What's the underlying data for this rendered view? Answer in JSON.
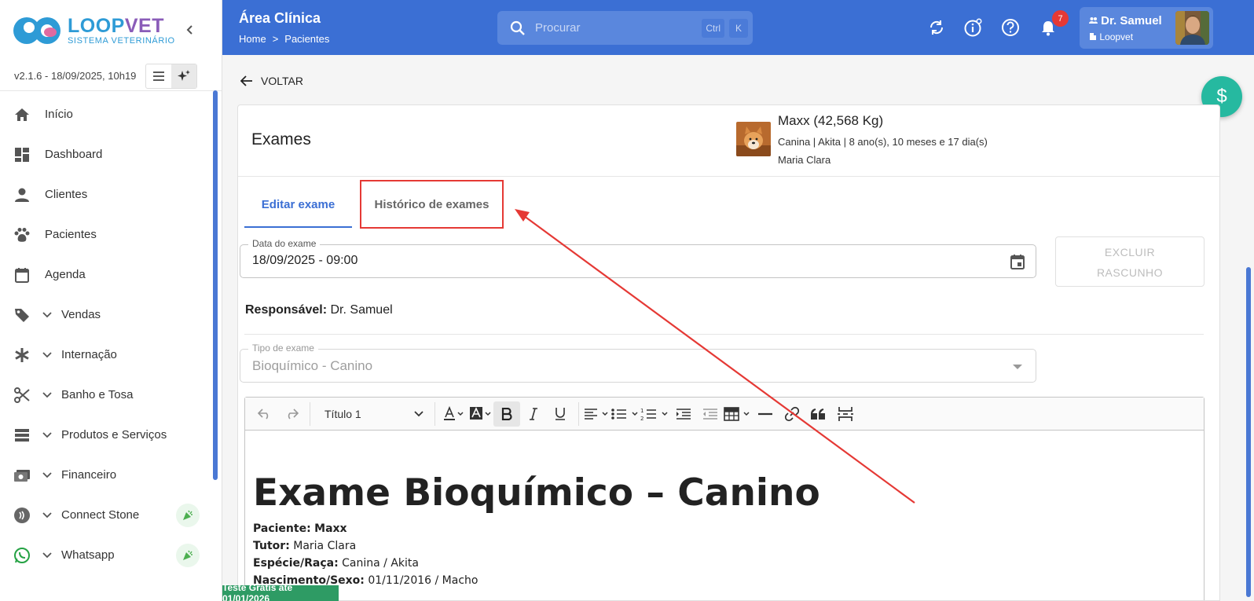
{
  "app": {
    "logo_name_a": "LOOP",
    "logo_name_b": "VET",
    "logo_sub": "SISTEMA VETERINÁRIO",
    "version": "v2.1.6 - 18/09/2025, 10h19"
  },
  "sidebar": {
    "items": [
      {
        "label": "Início",
        "icon": "home-icon"
      },
      {
        "label": "Dashboard",
        "icon": "dashboard-icon"
      },
      {
        "label": "Clientes",
        "icon": "person-icon"
      },
      {
        "label": "Pacientes",
        "icon": "paw-icon"
      },
      {
        "label": "Agenda",
        "icon": "calendar-icon"
      },
      {
        "label": "Vendas",
        "icon": "tag-icon"
      },
      {
        "label": "Internação",
        "icon": "asterisk-icon"
      },
      {
        "label": "Banho e Tosa",
        "icon": "scissors-icon"
      },
      {
        "label": "Produtos e Serviços",
        "icon": "list-icon"
      },
      {
        "label": "Financeiro",
        "icon": "money-icon"
      },
      {
        "label": "Connect Stone",
        "icon": "stone-icon"
      },
      {
        "label": "Whatsapp",
        "icon": "whatsapp-icon"
      }
    ]
  },
  "topbar": {
    "title": "Área Clínica",
    "breadcrumb_home": "Home",
    "breadcrumb_sep": ">",
    "breadcrumb_current": "Pacientes",
    "search_placeholder": "Procurar",
    "kbd_ctrl": "Ctrl",
    "kbd_k": "K",
    "notification_count": "7",
    "user_name": "Dr. Samuel",
    "user_org": "Loopvet"
  },
  "page": {
    "back_label": "VOLTAR",
    "fab_symbol": "$",
    "card_title": "Exames",
    "pet_name": "Maxx (42,568 Kg)",
    "pet_info": "Canina | Akita | 8 ano(s), 10 meses e 17 dia(s)",
    "pet_owner": "Maria Clara",
    "tabs": [
      {
        "label": "Editar exame"
      },
      {
        "label": "Histórico de exames"
      }
    ],
    "date_legend": "Data do exame",
    "date_value": "18/09/2025 - 09:00",
    "delete_draft_line1": "EXCLUIR",
    "delete_draft_line2": "RASCUNHO",
    "responsible_label": "Responsável:",
    "responsible_value": "Dr. Samuel",
    "exam_type_legend": "Tipo de exame",
    "exam_type_value": "Bioquímico - Canino"
  },
  "editor": {
    "heading_select": "Título 1",
    "doc_title": "Exame Bioquímico – Canino",
    "lines": [
      {
        "label": "Paciente:",
        "value": "Maxx",
        "bold_value": true
      },
      {
        "label": "Tutor:",
        "value": "Maria Clara",
        "bold_value": false
      },
      {
        "label": "Espécie/Raça:",
        "value": "Canina / Akita",
        "bold_value": false
      },
      {
        "label": "Nascimento/Sexo:",
        "value": "01/11/2016 / Macho",
        "bold_value": false
      }
    ]
  },
  "footer": {
    "trial": "Teste Grátis até 01/01/2026"
  }
}
